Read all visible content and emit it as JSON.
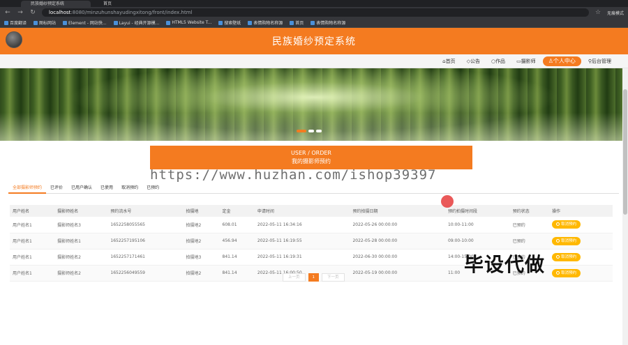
{
  "browser": {
    "tabs": [
      "民族婚纱预定系统",
      "首页"
    ],
    "url_host": "localhost",
    "url_path": ":8080/minzuhunshayudingxitong/front/index.html",
    "profile": "无痕模式",
    "bookmarks": [
      "百度翻译",
      "图标网站",
      "Element - 网站快...",
      "Layui - 经典开源模...",
      "HTML5 Website T...",
      "搜索壁纸",
      "表情购物名称源",
      "首页",
      "表情购物名称源"
    ]
  },
  "site": {
    "title": "民族婚纱预定系统",
    "nav": [
      "首页",
      "公告",
      "作品",
      "摄影师",
      "个人中心",
      "后台管理"
    ]
  },
  "order": {
    "title_en": "USER / ORDER",
    "title_cn": "我的摄影师预约"
  },
  "watermark": "https://www.huzhan.com/ishop39397",
  "overlay_text": "毕设代做",
  "tabs": [
    "全部摄影师预约",
    "已评价",
    "已用户确认",
    "已使用",
    "取消预约",
    "已预约"
  ],
  "table": {
    "headers": [
      "用户姓名",
      "摄影师姓名",
      "预约流水号",
      "拍摄地",
      "定金",
      "申请时间",
      "预约拍摄日期",
      "预约拍摄时间段",
      "预约状态",
      "操作"
    ],
    "rows": [
      [
        "用户姓名1",
        "摄影师姓名3",
        "1652258055565",
        "拍摄地2",
        "608.01",
        "2022-05-11 16:34:16",
        "2022-05-26 00:00:00",
        "10:00-11:00",
        "已预约"
      ],
      [
        "用户姓名1",
        "摄影师姓名1",
        "1652257195106",
        "拍摄地2",
        "456.94",
        "2022-05-11 16:19:55",
        "2022-05-28 00:00:00",
        "09:00-10:00",
        "已预约"
      ],
      [
        "用户姓名1",
        "摄影师姓名2",
        "1652257171461",
        "拍摄地3",
        "841.14",
        "2022-05-11 16:19:31",
        "2022-06-30 00:00:00",
        "14:00-15:00",
        "已预约"
      ],
      [
        "用户姓名1",
        "摄影师姓名2",
        "1652256049559",
        "拍摄地2",
        "841.14",
        "2022-05-11 16:00:50",
        "2022-05-19 00:00:00",
        "11:00",
        "已预约"
      ]
    ],
    "action_label": "取消预约"
  },
  "pager": {
    "prev": "上一页",
    "current": "1",
    "next": "下一页"
  }
}
